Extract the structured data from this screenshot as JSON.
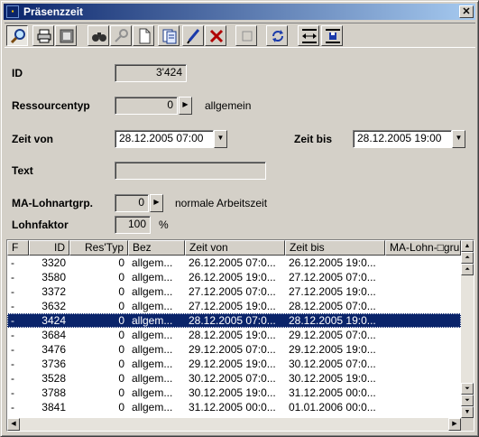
{
  "window": {
    "title": "Präsenzzeit"
  },
  "toolbar": {
    "buttons": [
      {
        "icon": "magnifier-icon"
      },
      {
        "icon": "printer-icon"
      },
      {
        "icon": "print-preview-icon"
      },
      {
        "icon": "binoculars-icon"
      },
      {
        "icon": "search-key-icon"
      },
      {
        "icon": "new-document-icon"
      },
      {
        "icon": "copy-document-icon"
      },
      {
        "icon": "edit-pen-icon"
      },
      {
        "icon": "delete-x-icon"
      },
      {
        "icon": "blank-icon"
      },
      {
        "icon": "refresh-icon"
      },
      {
        "icon": "expand-columns-icon"
      },
      {
        "icon": "save-columns-icon"
      }
    ]
  },
  "form": {
    "id_label": "ID",
    "id_value": "3'424",
    "ressourcentyp_label": "Ressourcentyp",
    "ressourcentyp_value": "0",
    "ressourcentyp_text": "allgemein",
    "zeit_von_label": "Zeit von",
    "zeit_von_value": "28.12.2005  07:00",
    "zeit_bis_label": "Zeit bis",
    "zeit_bis_value": "28.12.2005  19:00",
    "text_label": "Text",
    "text_value": "",
    "ma_lohnartgrp_label": "MA-Lohnartgrp.",
    "ma_lohnartgrp_value": "0",
    "ma_lohnartgrp_text": "normale Arbeitszeit",
    "lohnfaktor_label": "Lohnfaktor",
    "lohnfaktor_value": "100",
    "lohnfaktor_unit": "%"
  },
  "table": {
    "columns": [
      "F",
      "ID",
      "Res'Typ",
      "Bez",
      "Zeit von",
      "Zeit bis",
      "MA-Lohn-□gru"
    ],
    "selected_index": 4,
    "rows": [
      [
        "-",
        "3320",
        "0",
        "allgem...",
        "26.12.2005 07:0...",
        "26.12.2005 19:0..."
      ],
      [
        "-",
        "3580",
        "0",
        "allgem...",
        "26.12.2005 19:0...",
        "27.12.2005 07:0..."
      ],
      [
        "-",
        "3372",
        "0",
        "allgem...",
        "27.12.2005 07:0...",
        "27.12.2005 19:0..."
      ],
      [
        "-",
        "3632",
        "0",
        "allgem...",
        "27.12.2005 19:0...",
        "28.12.2005 07:0..."
      ],
      [
        "-",
        "3424",
        "0",
        "allgem...",
        "28.12.2005 07:0...",
        "28.12.2005 19:0..."
      ],
      [
        "-",
        "3684",
        "0",
        "allgem...",
        "28.12.2005 19:0...",
        "29.12.2005 07:0..."
      ],
      [
        "-",
        "3476",
        "0",
        "allgem...",
        "29.12.2005 07:0...",
        "29.12.2005 19:0..."
      ],
      [
        "-",
        "3736",
        "0",
        "allgem...",
        "29.12.2005 19:0...",
        "30.12.2005 07:0..."
      ],
      [
        "-",
        "3528",
        "0",
        "allgem...",
        "30.12.2005 07:0...",
        "30.12.2005 19:0..."
      ],
      [
        "-",
        "3788",
        "0",
        "allgem...",
        "30.12.2005 19:0...",
        "31.12.2005 00:0..."
      ],
      [
        "-",
        "3841",
        "0",
        "allgem...",
        "31.12.2005 00:0...",
        "01.01.2006 00:0..."
      ]
    ]
  }
}
